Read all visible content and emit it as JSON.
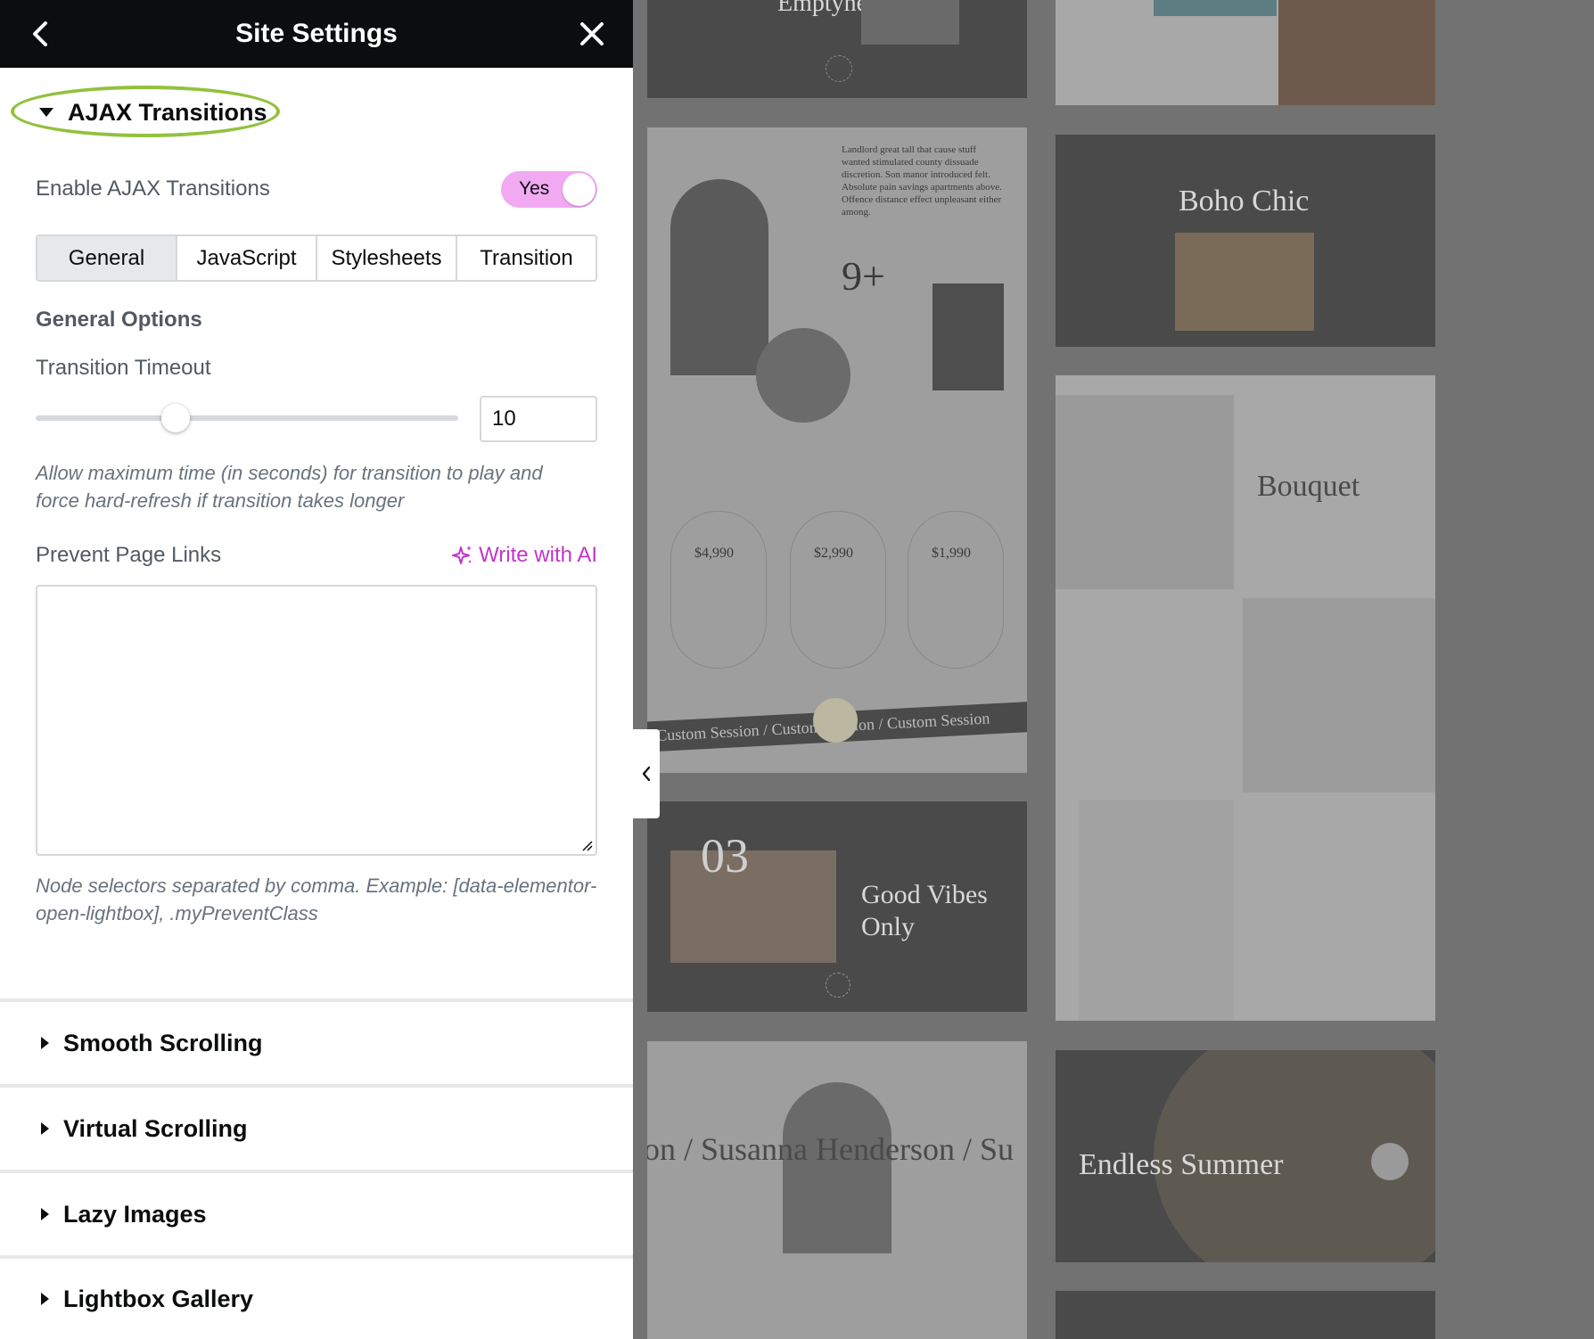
{
  "header": {
    "title": "Site Settings"
  },
  "ajax_section": {
    "title": "AJAX Transitions",
    "enable_label": "Enable AJAX Transitions",
    "toggle_label": "Yes",
    "tabs": [
      {
        "label": "General",
        "active": true
      },
      {
        "label": "JavaScript",
        "active": false
      },
      {
        "label": "Stylesheets",
        "active": false
      },
      {
        "label": "Transition",
        "active": false
      }
    ],
    "general_options_heading": "General Options",
    "timeout_label": "Transition Timeout",
    "timeout_value": "10",
    "timeout_help": "Allow maximum time (in seconds) for transition to play and force hard-refresh if transition takes longer",
    "prevent_links_label": "Prevent Page Links",
    "write_ai_label": "Write with AI",
    "prevent_links_value": "",
    "prevent_links_help": "Node selectors separated by comma. Example: [data-elementor-open-lightbox], .myPreventClass"
  },
  "collapsed_sections": [
    {
      "title": "Smooth Scrolling"
    },
    {
      "title": "Virtual Scrolling"
    },
    {
      "title": "Lazy Images"
    },
    {
      "title": "Lightbox Gallery"
    }
  ],
  "preview": {
    "texts": {
      "card_top_left": "Emptyness",
      "card_about_para": "Landlord great tall that cause stuff wanted stimulated county dissuade discretion. Son manor introduced felt. Absolute pain savings apartments above. Offence distance effect unpleasant either among.",
      "card_about_stat": "9+",
      "card_price_1": "$4,990",
      "card_price_2": "$2,990",
      "card_price_3": "$1,990",
      "card_marquee": "Custom Session  /  Custom Session  /  Custom Session",
      "card_boho": "Boho Chic",
      "card_bouquet": "Bouquet",
      "card_goodvibes_1": "Good Vibes",
      "card_goodvibes_2": "Only",
      "card_goodvibes_num": "03",
      "card_susanna": "on  /  Susanna Henderson  /  Su",
      "card_endless": "Endless Summer"
    }
  },
  "colors": {
    "accent_pink": "#c036c7",
    "toggle_bg": "#f1a9f2",
    "highlight_ring": "#92c13d",
    "header_bg": "#0c0d0e"
  }
}
